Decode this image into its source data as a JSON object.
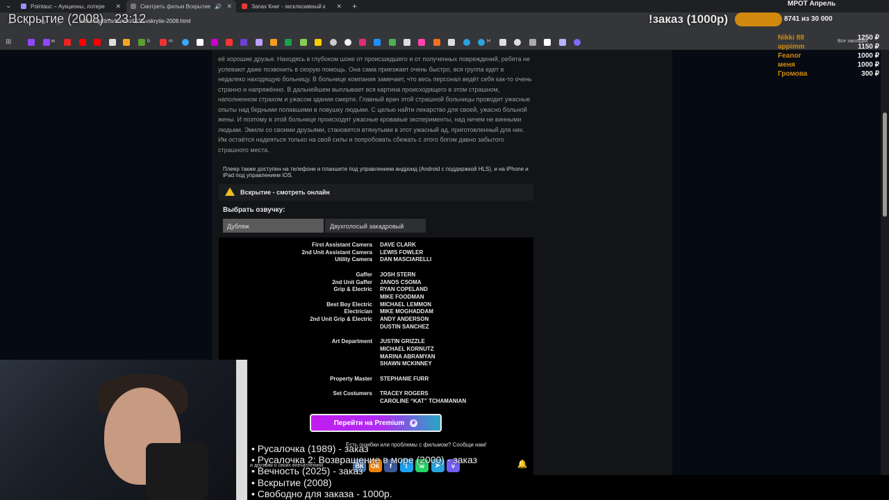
{
  "tabs": [
    {
      "title": "Pointauc – Аукционы, лотере",
      "color": "#a0a0ff"
    },
    {
      "title": "Смотреть фильм Вскрытие",
      "color": "#888"
    },
    {
      "title": "Запах Книг - эксклюзивный к",
      "color": "#e23a3a"
    }
  ],
  "address": {
    "url": "rezka.ag/films/horror/4378-vskrytie-2008.html"
  },
  "bookmarks": {
    "m1": "м",
    "b": "b",
    "m2": "m",
    "h": "H",
    "all": "Все закладки"
  },
  "description": "её хорошие друзья. Находясь в глубоком шоке от происшедшего и от полученных повреждений, ребята не успевают даже позвонить в скорую помощь. Она сама приезжает очень быстро, вся группа едет в недалеко находящую больницу. В больнице компания замечает, что весь персонал ведёт себя как-то очень странно и напряжённо. В дальнейшем выплывает вся картина происходящего в этом страшном, наполненном страхом и ужасом здании смерти. Главный врач этой страшной больницы проводит ужасные опыты над бедными попавшими в повушку людьми. С целью найти лекарство для своей, ужасно больной жены. И поэтому в этой больнице происходят ужасные кровавые эксперименты, над ничем не винными людьми. Эмили со своими друзьями, становятся втянутыми в этот ужасный ад, приготовленный для них. Им остаётся надеяться только на свой силы и попробовать сбежать с этого богом давно забытого страшного места.",
  "player_note": "Плеер также доступен на телефоне и планшете под управлением андроид (Android с поддержкой HLS), и на iPhone и iPad под управлением iOS.",
  "watch_title": "Вскрытие - смотреть онлайн",
  "voice": {
    "label": "Выбрать озвучку:",
    "options": [
      "Дубляж",
      "Двухголосый закадровый"
    ]
  },
  "credits": [
    {
      "role": "First Assistant Camera",
      "name": "DAVE CLARK"
    },
    {
      "role": "2nd Unit Assistant Camera",
      "name": "LEWIS FOWLER"
    },
    {
      "role": "Utility Camera",
      "name": "DAN MASCIARELLI"
    },
    {
      "role": "Gaffer",
      "name": "JOSH STERN"
    },
    {
      "role": "2nd Unit Gaffer",
      "name": "JANOS CSOMA"
    },
    {
      "role": "Grip & Electric",
      "name": "RYAN COPELAND"
    },
    {
      "role": "",
      "name": "MIKE FOODMAN"
    },
    {
      "role": "Best Boy Electric",
      "name": "MICHAEL LEMMON"
    },
    {
      "role": "Electrician",
      "name": "MIKE MOGHADDAM"
    },
    {
      "role": "2nd Unit Grip & Electric",
      "name": "ANDY ANDERSON"
    },
    {
      "role": "",
      "name": "DUSTIN SANCHEZ"
    },
    {
      "role": "Art Department",
      "name": "JUSTIN GRIZZLE"
    },
    {
      "role": "",
      "name": "MICHAEL KORNUTZ"
    },
    {
      "role": "",
      "name": "MARINA ABRAMYAN"
    },
    {
      "role": "",
      "name": "SHAWN MCKINNEY"
    },
    {
      "role": "Property Master",
      "name": "STEPHANIE FURR"
    },
    {
      "role": "Set Costumers",
      "name": "TRACEY ROGERS"
    },
    {
      "role": "",
      "name": "CAROLINE “KAT” TCHAMANIAN"
    }
  ],
  "premium": {
    "label": "Перейти на Premium",
    "coin": "₽"
  },
  "errors_text": "Есть ошибки или проблемы с фильмом? Сообщи нам!",
  "share_text": "и друзьям о своих впечатлениях",
  "social": [
    {
      "icon": "vk-icon",
      "glyph": "ВК",
      "color": "#4a76a8"
    },
    {
      "icon": "odnoklassniki-icon",
      "glyph": "ОК",
      "color": "#ee8208"
    },
    {
      "icon": "facebook-icon",
      "glyph": "f",
      "color": "#3b5998"
    },
    {
      "icon": "twitter-icon",
      "glyph": "t",
      "color": "#1da1f2"
    },
    {
      "icon": "whatsapp-icon",
      "glyph": "w",
      "color": "#25d366"
    },
    {
      "icon": "telegram-icon",
      "glyph": "➤",
      "color": "#2aa3df"
    },
    {
      "icon": "viber-icon",
      "glyph": "v",
      "color": "#7360f2"
    }
  ],
  "overlay": {
    "now_title": "Вскрытие (2008) - 23:12",
    "order": "!заказ (1000р)",
    "progress": "8741  из 30 000",
    "progress_fraction": 0.29,
    "mrot": "МРОТ Апрель",
    "donors": [
      {
        "name": "Nikki 88",
        "amount": "1250 ₽"
      },
      {
        "name": "appimm",
        "amount": "1150 ₽"
      },
      {
        "name": "Feanor",
        "amount": "1000 ₽"
      },
      {
        "name": "меня",
        "amount": "1000 ₽"
      },
      {
        "name": "Громова",
        "amount": "300 ₽"
      }
    ],
    "queue": [
      "• Русалочка (1989) - заказ",
      "• Русалочка 2: Возвращение в море (2000) - заказ",
      "• Вечность (2025) - заказ",
      "• Вскрытие (2008)",
      "• Свободно для заказа - 1000р."
    ]
  }
}
